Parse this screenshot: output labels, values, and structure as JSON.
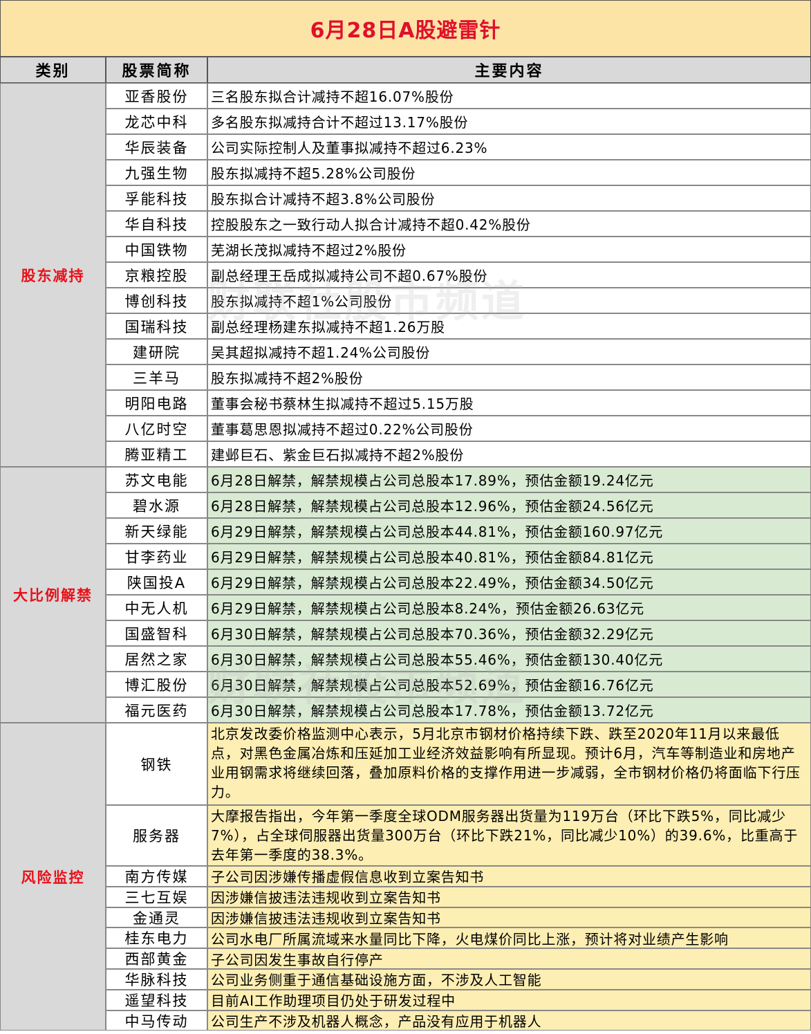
{
  "title": "6月28日A股避雷针",
  "headers": {
    "category": "类别",
    "stock": "股票简称",
    "content": "主要内容"
  },
  "sections": [
    {
      "category": "股东减持",
      "bg": "white",
      "rows": [
        {
          "stock": "亚香股份",
          "content": "三名股东拟合计减持不超16.07%股份"
        },
        {
          "stock": "龙芯中科",
          "content": "多名股东拟减持合计不超过13.17%股份"
        },
        {
          "stock": "华辰装备",
          "content": "公司实际控制人及董事拟减持不超过6.23%"
        },
        {
          "stock": "九强生物",
          "content": "股东拟减持不超5.28%公司股份"
        },
        {
          "stock": "孚能科技",
          "content": "股东拟合计减持不超3.8%公司股份"
        },
        {
          "stock": "华自科技",
          "content": "控股股东之一致行动人拟合计减持不超0.42%股份"
        },
        {
          "stock": "中国铁物",
          "content": "芜湖长茂拟减持不超过2%股份"
        },
        {
          "stock": "京粮控股",
          "content": "副总经理王岳成拟减持公司不超0.67%股份"
        },
        {
          "stock": "博创科技",
          "content": "股东拟减持不超1%公司股份"
        },
        {
          "stock": "国瑞科技",
          "content": "副总经理杨建东拟减持不超1.26万股"
        },
        {
          "stock": "建研院",
          "content": "吴其超拟减持不超1.24%公司股份"
        },
        {
          "stock": "三羊马",
          "content": "股东拟减持不超2%股份"
        },
        {
          "stock": "明阳电路",
          "content": "董事会秘书蔡林生拟减持不超过5.15万股"
        },
        {
          "stock": "八亿时空",
          "content": "董事葛思恩拟减持不超过0.22%公司股份"
        },
        {
          "stock": "腾亚精工",
          "content": "建邺巨石、紫金巨石拟减持不超2%股份"
        }
      ]
    },
    {
      "category": "大比例解禁",
      "bg": "green",
      "rows": [
        {
          "stock": "苏文电能",
          "content": "6月28日解禁，解禁规模占公司总股本17.89%，预估金额19.24亿元"
        },
        {
          "stock": "碧水源",
          "content": "6月28日解禁，解禁规模占公司总股本12.96%，预估金额24.56亿元"
        },
        {
          "stock": "新天绿能",
          "content": "6月29日解禁，解禁规模占公司总股本44.81%，预估金额160.97亿元"
        },
        {
          "stock": "甘李药业",
          "content": "6月29日解禁，解禁规模占公司总股本40.81%，预估金额84.81亿元"
        },
        {
          "stock": "陕国投A",
          "content": "6月29日解禁，解禁规模占公司总股本22.49%，预估金额34.50亿元"
        },
        {
          "stock": "中无人机",
          "content": "6月29日解禁，解禁规模占公司总股本8.24%，预估金额26.63亿元"
        },
        {
          "stock": "国盛智科",
          "content": "6月30日解禁，解禁规模占公司总股本70.36%，预估金额32.29亿元"
        },
        {
          "stock": "居然之家",
          "content": "6月30日解禁，解禁规模占公司总股本55.46%，预估金额130.40亿元"
        },
        {
          "stock": "博汇股份",
          "content": "6月30日解禁，解禁规模占公司总股本52.69%，预估金额16.76亿元"
        },
        {
          "stock": "福元医药",
          "content": "6月30日解禁，解禁规模占公司总股本17.78%，预估金额13.72亿元"
        }
      ]
    },
    {
      "category": "风险监控",
      "bg": "yellow",
      "rows": [
        {
          "stock": "钢铁",
          "content": "北京发改委价格监测中心表示，5月北京市钢材价格持续下跌、跌至2020年11月以来最低点，对黑色金属冶炼和压延加工业经济效益影响有所显现。预计6月，汽车等制造业和房地产业用钢需求将继续回落，叠加原料价格的支撑作用进一步减弱，全市钢材价格仍将面临下行压力。"
        },
        {
          "stock": "服务器",
          "content": "大摩报告指出，今年第一季度全球ODM服务器出货量为119万台（环比下跌5%，同比减少7%），占全球伺服器出货量300万台（环比下跌21%，同比减少10%）的39.6%，比重高于去年第一季度的38.3%。"
        },
        {
          "stock": "南方传媒",
          "content": "子公司因涉嫌传播虚假信息收到立案告知书"
        },
        {
          "stock": "三七互娱",
          "content": "因涉嫌信披违法违规收到立案告知书"
        },
        {
          "stock": "金通灵",
          "content": "因涉嫌信披违法违规收到立案告知书"
        },
        {
          "stock": "桂东电力",
          "content": "公司水电厂所属流域来水量同比下降，火电煤价同比上涨，预计将对业绩产生影响"
        },
        {
          "stock": "西部黄金",
          "content": "子公司因发生事故自行停产"
        },
        {
          "stock": "华脉科技",
          "content": "公司业务侧重于通信基础设施方面，不涉及人工智能"
        },
        {
          "stock": "遥望科技",
          "content": "目前AI工作助理项目仍处于研发过程中"
        },
        {
          "stock": "中马传动",
          "content": "公司生产不涉及机器人概念，产品没有应用于机器人"
        }
      ]
    }
  ],
  "watermark_text": "财联社股市频道"
}
